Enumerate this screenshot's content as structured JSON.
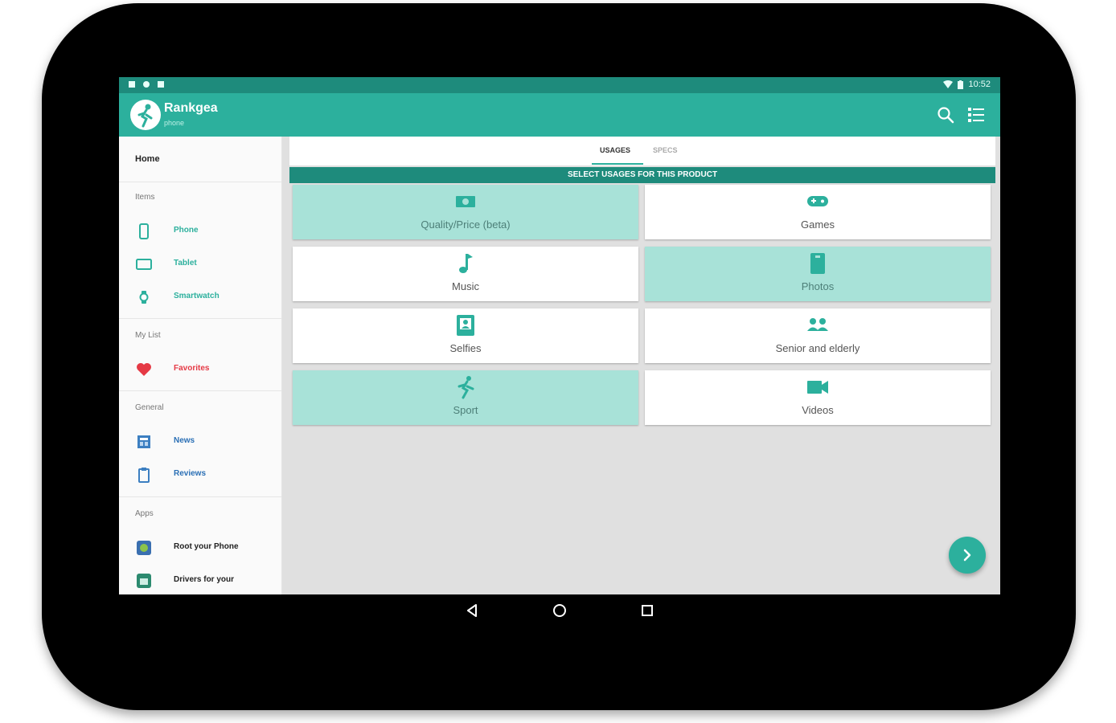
{
  "status_bar": {
    "time": "10:52"
  },
  "app_bar": {
    "brand": "Rankgea",
    "brand_sub": "phone"
  },
  "drawer": {
    "home": "Home",
    "sections": {
      "items": "Items",
      "my_list": "My List",
      "general": "General",
      "apps": "Apps"
    },
    "items": [
      {
        "label": "Phone",
        "icon": "phone-icon"
      },
      {
        "label": "Tablet",
        "icon": "tablet-icon"
      },
      {
        "label": "Smartwatch",
        "icon": "smartwatch-icon"
      }
    ],
    "my_list": [
      {
        "label": "Favorites",
        "icon": "heart-icon"
      }
    ],
    "general": [
      {
        "label": "News",
        "icon": "news-icon"
      },
      {
        "label": "Reviews",
        "icon": "reviews-icon"
      }
    ],
    "apps": [
      {
        "label": "Root your Phone",
        "icon": "root-app-icon"
      },
      {
        "label": "Drivers for your",
        "icon": "drivers-app-icon"
      }
    ]
  },
  "tabs": {
    "usages": "USAGES",
    "specs": "SPECS"
  },
  "header_strip": "SELECT USAGES FOR THIS PRODUCT",
  "usages": [
    {
      "label": "Quality/Price (beta)",
      "icon": "money-icon",
      "selected": true
    },
    {
      "label": "Games",
      "icon": "gamepad-icon",
      "selected": false
    },
    {
      "label": "Music",
      "icon": "music-note-icon",
      "selected": false
    },
    {
      "label": "Photos",
      "icon": "photo-icon",
      "selected": true
    },
    {
      "label": "Selfies",
      "icon": "selfie-icon",
      "selected": false
    },
    {
      "label": "Senior and elderly",
      "icon": "people-icon",
      "selected": false
    },
    {
      "label": "Sport",
      "icon": "running-icon",
      "selected": true
    },
    {
      "label": "Videos",
      "icon": "video-camera-icon",
      "selected": false
    }
  ],
  "colors": {
    "primary": "#2cb09d",
    "primary_dark": "#1e8b7c",
    "selected_card": "#a8e2d8",
    "favorites_red": "#e53945"
  }
}
